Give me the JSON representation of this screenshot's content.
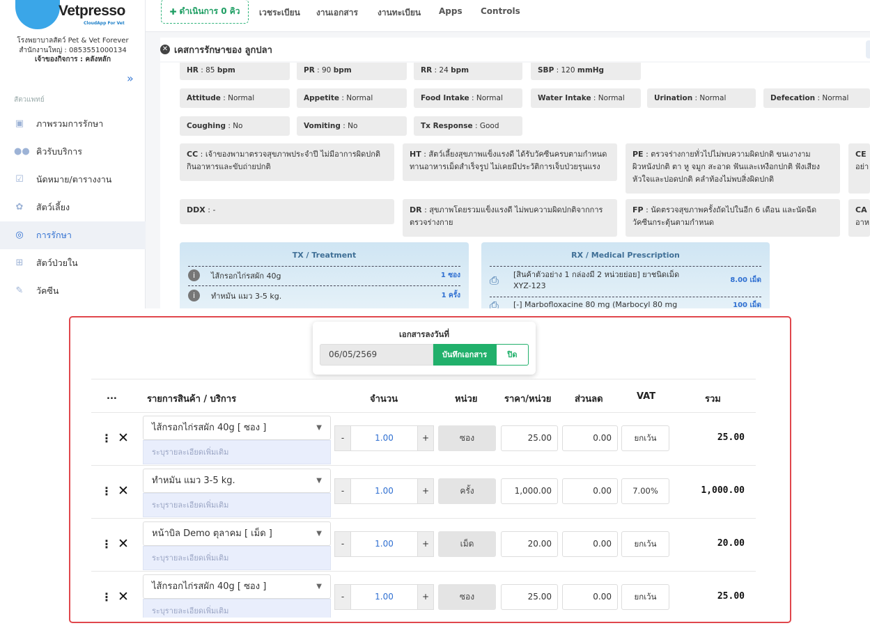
{
  "brand": {
    "name": "Vetpresso",
    "tagline": "CloudApp For Vet"
  },
  "clinic": {
    "name": "โรงพยาบาลสัตว์ Pet & Vet Forever",
    "branch": "สำนักงานใหญ่ : 0853551000134",
    "owner": "เจ้าของกิจการ : คลังหลัก"
  },
  "sidebar": {
    "section": "สัตวแพทย์",
    "items": [
      {
        "label": "ภาพรวมการรักษา"
      },
      {
        "label": "คิวรับบริการ"
      },
      {
        "label": "นัดหมาย/ตารางงาน"
      },
      {
        "label": "สัตว์เลี้ยง"
      },
      {
        "label": "การรักษา"
      },
      {
        "label": "สัตว์ป่วยใน"
      },
      {
        "label": "วัคซีน"
      }
    ]
  },
  "topbar": {
    "active_tab": "ดำเนินการ 0 คิว",
    "tabs": [
      "เวชระเบียน",
      "งานเอกสาร",
      "งานทะเบียน",
      "Apps",
      "Controls"
    ]
  },
  "header": {
    "title": "เคสการรักษาของ ลูกปลา"
  },
  "vitals": {
    "hr": {
      "label": "HR",
      "value": ": 85",
      "unit": "bpm"
    },
    "pr": {
      "label": "PR",
      "value": ": 90",
      "unit": "bpm"
    },
    "rr": {
      "label": "RR",
      "value": ": 24",
      "unit": "bpm"
    },
    "sbp": {
      "label": "SBP",
      "value": ": 120",
      "unit": "mmHg"
    }
  },
  "observations": {
    "attitude": {
      "label": "Attitude",
      "value": ": Normal"
    },
    "appetite": {
      "label": "Appetite",
      "value": ": Normal"
    },
    "food": {
      "label": "Food Intake",
      "value": ": Normal"
    },
    "water": {
      "label": "Water Intake",
      "value": ": Normal"
    },
    "urination": {
      "label": "Urination",
      "value": ": Normal"
    },
    "defecation": {
      "label": "Defecation",
      "value": ": Normal"
    },
    "coughing": {
      "label": "Coughing",
      "value": ": No"
    },
    "vomiting": {
      "label": "Vomiting",
      "value": ": No"
    },
    "tx_response": {
      "label": "Tx Response",
      "value": ": Good"
    }
  },
  "notes": {
    "cc": {
      "label": "CC",
      "text": ": เจ้าของพามาตรวจสุขภาพประจำปี ไม่มีอาการผิดปกติ กินอาหารและขับถ่ายปกติ"
    },
    "ht": {
      "label": "HT",
      "text": ": สัตว์เลี้ยงสุขภาพแข็งแรงดี ได้รับวัคซีนครบตามกำหนด ทานอาหารเม็ดสำเร็จรูป ไม่เคยมีประวัติการเจ็บป่วยรุนแรง"
    },
    "pe": {
      "label": "PE",
      "text": ": ตรวจร่างกายทั่วไปไม่พบความผิดปกติ ขนเงางาม ผิวหนังปกติ ตา หู จมูก สะอาด ฟันและเหงือกปกติ ฟังเสียงหัวใจและปอดปกติ คลำท้องไม่พบสิ่งผิดปกติ"
    },
    "ce": {
      "label": "CE",
      "text": "อย่า"
    },
    "ddx": {
      "label": "DDX",
      "text": ": -"
    },
    "dr": {
      "label": "DR",
      "text": ": สุขภาพโดยรวมแข็งแรงดี ไม่พบความผิดปกติจากการตรวจร่างกาย"
    },
    "fp": {
      "label": "FP",
      "text": ": นัดตรวจสุขภาพครั้งถัดไปในอีก 6 เดือน และนัดฉีดวัคซีนกระตุ้นตามกำหนด"
    },
    "ca": {
      "label": "CA",
      "text": "อาหา"
    }
  },
  "tx_panel": {
    "title": "TX / Treatment",
    "items": [
      {
        "name": "ไส้กรอกไก่รสผัก 40g",
        "qty": "1 ซอง"
      },
      {
        "name": "ทำหมัน แมว 3-5 kg.",
        "qty": "1 ครั้ง"
      }
    ]
  },
  "rx_panel": {
    "title": "RX / Medical Prescription",
    "items": [
      {
        "name": "[สินค้าตัวอย่าง 1 กล่องมี 2 หน่วยย่อย] ยาชนิดเม็ด XYZ-123",
        "qty": "8.00 เม็ด"
      },
      {
        "name": "[-] Marbofloxacine 80 mg (Marbocyl 80 mg",
        "qty": "100 เม็ด"
      }
    ]
  },
  "doc_dialog": {
    "title": "เอกสารลงวันที่",
    "date": "06/05/2569",
    "save_label": "บันทึกเอกสาร",
    "close_label": "ปิด"
  },
  "table": {
    "headers": {
      "more": "...",
      "item": "รายการสินค้า / บริการ",
      "qty": "จำนวน",
      "unit": "หน่วย",
      "price": "ราคา/หน่วย",
      "discount": "ส่วนลด",
      "vat": "VAT",
      "total": "รวม"
    },
    "note_placeholder": "ระบุรายละเอียดเพิ่มเติม",
    "rows": [
      {
        "item": "ไส้กรอกไก่รสผัก 40g [ ซอง ]",
        "qty": "1.00",
        "unit": "ซอง",
        "price": "25.00",
        "discount": "0.00",
        "vat": "ยกเว้น",
        "total": "25.00"
      },
      {
        "item": "ทำหมัน แมว 3-5 kg.",
        "qty": "1.00",
        "unit": "ครั้ง",
        "price": "1,000.00",
        "discount": "0.00",
        "vat": "7.00%",
        "total": "1,000.00"
      },
      {
        "item": "หน้าบิล Demo ตุลาคม [ เม็ด ]",
        "qty": "1.00",
        "unit": "เม็ด",
        "price": "20.00",
        "discount": "0.00",
        "vat": "ยกเว้น",
        "total": "20.00"
      },
      {
        "item": "ไส้กรอกไก่รสผัก 40g [ ซอง ]",
        "qty": "1.00",
        "unit": "ซอง",
        "price": "25.00",
        "discount": "0.00",
        "vat": "ยกเว้น",
        "total": "25.00"
      }
    ]
  },
  "colors": {
    "accent": "#2f6fd1",
    "success": "#21b06b",
    "highlight": "#e0474c"
  }
}
